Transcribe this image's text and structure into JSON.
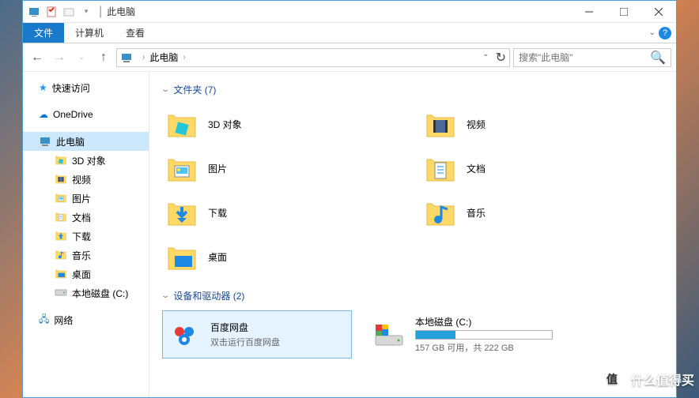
{
  "title": "此电脑",
  "ribbon": {
    "file": "文件",
    "computer": "计算机",
    "view": "查看"
  },
  "breadcrumb": {
    "root": "此电脑"
  },
  "search": {
    "placeholder": "搜索\"此电脑\""
  },
  "sidebar": {
    "quick_access": "快速访问",
    "onedrive": "OneDrive",
    "this_pc": "此电脑",
    "children": [
      {
        "label": "3D 对象",
        "icon": "3d"
      },
      {
        "label": "视频",
        "icon": "video"
      },
      {
        "label": "图片",
        "icon": "pictures"
      },
      {
        "label": "文档",
        "icon": "documents"
      },
      {
        "label": "下载",
        "icon": "downloads"
      },
      {
        "label": "音乐",
        "icon": "music"
      },
      {
        "label": "桌面",
        "icon": "desktop"
      },
      {
        "label": "本地磁盘 (C:)",
        "icon": "drive"
      }
    ],
    "network": "网络"
  },
  "groups": {
    "folders": {
      "header": "文件夹 (7)"
    },
    "devices": {
      "header": "设备和驱动器 (2)"
    }
  },
  "folders": [
    {
      "label": "3D 对象",
      "icon": "3d"
    },
    {
      "label": "视频",
      "icon": "video"
    },
    {
      "label": "图片",
      "icon": "pictures"
    },
    {
      "label": "文档",
      "icon": "documents"
    },
    {
      "label": "下载",
      "icon": "downloads"
    },
    {
      "label": "音乐",
      "icon": "music"
    },
    {
      "label": "桌面",
      "icon": "desktop"
    }
  ],
  "devices": {
    "baidu": {
      "name": "百度网盘",
      "sub": "双击运行百度网盘"
    },
    "drive_c": {
      "name": "本地磁盘 (C:)",
      "sub": "157 GB 可用，共 222 GB",
      "used_pct": 29
    }
  },
  "watermark": "什么值得买"
}
